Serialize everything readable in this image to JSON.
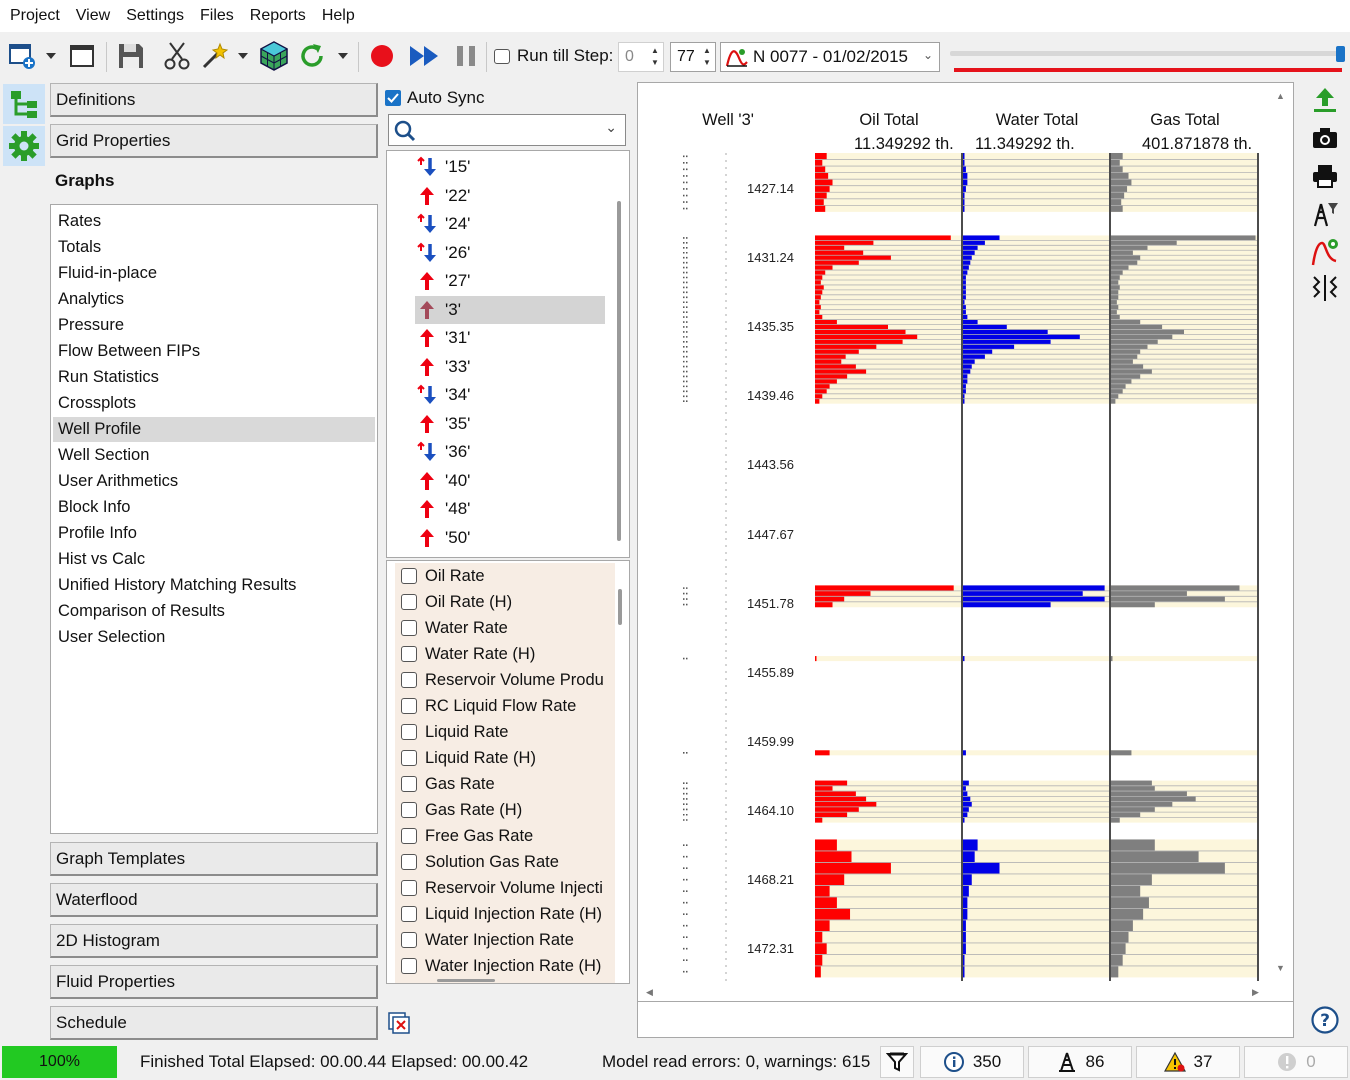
{
  "menu": [
    "Project",
    "View",
    "Settings",
    "Files",
    "Reports",
    "Help"
  ],
  "toolbar": {
    "run_till_step_label": "Run till Step:",
    "run_till_step_value": "0",
    "step_value": "77",
    "step_name": "N 0077 - 01/02/2015"
  },
  "left_panel": {
    "sections_top": [
      "Definitions",
      "Grid Properties",
      "Graphs"
    ],
    "graphs_items": [
      "Rates",
      "Totals",
      "Fluid-in-place",
      "Analytics",
      "Pressure",
      "Flow Between FIPs",
      "Run Statistics",
      "Crossplots",
      "Well Profile",
      "Well Section",
      "User Arithmetics",
      "Block Info",
      "Profile Info",
      "Hist vs Calc",
      "Unified History Matching Results",
      "Comparison of Results",
      "User Selection"
    ],
    "selected_graph": "Well Profile",
    "sections_bottom": [
      "Graph Templates",
      "Waterflood",
      "2D Histogram",
      "Fluid Properties",
      "Schedule"
    ]
  },
  "middle_panel": {
    "auto_sync_label": "Auto Sync",
    "search_value": "",
    "wells": [
      {
        "name": "'15'",
        "type": "injector"
      },
      {
        "name": "'22'",
        "type": "producer"
      },
      {
        "name": "'24'",
        "type": "injector"
      },
      {
        "name": "'26'",
        "type": "injector"
      },
      {
        "name": "'27'",
        "type": "producer"
      },
      {
        "name": "'3'",
        "type": "producer"
      },
      {
        "name": "'31'",
        "type": "producer"
      },
      {
        "name": "'33'",
        "type": "producer"
      },
      {
        "name": "'34'",
        "type": "injector"
      },
      {
        "name": "'35'",
        "type": "producer"
      },
      {
        "name": "'36'",
        "type": "injector"
      },
      {
        "name": "'40'",
        "type": "producer"
      },
      {
        "name": "'48'",
        "type": "producer"
      },
      {
        "name": "'50'",
        "type": "producer"
      }
    ],
    "selected_well": "'3'",
    "variables": [
      "Oil Rate",
      "Oil Rate (H)",
      "Water Rate",
      "Water Rate (H)",
      "Reservoir Volume Produ",
      "RC Liquid Flow Rate",
      "Liquid Rate",
      "Liquid Rate (H)",
      "Gas Rate",
      "Gas Rate (H)",
      "Free Gas Rate",
      "Solution Gas Rate",
      "Reservoir Volume Injecti",
      "Liquid Injection Rate (H)",
      "Water Injection Rate",
      "Water Injection Rate (H)"
    ]
  },
  "chart": {
    "well_label": "Well '3'",
    "tracks": [
      {
        "title": "Oil Total",
        "total": "11.349292 th."
      },
      {
        "title": "Water Total",
        "total": "11.349292 th."
      },
      {
        "title": "Gas Total",
        "total": "401.871878 th."
      }
    ],
    "depth_labels": [
      "1427.14",
      "1431.24",
      "1435.35",
      "1439.46",
      "1443.56",
      "1447.67",
      "1451.78",
      "1455.89",
      "1459.99",
      "1464.10",
      "1468.21",
      "1472.31"
    ],
    "colors": {
      "oil": "#ff0000",
      "water": "#0000e6",
      "gas": "#7f7f7f",
      "track_bg": "#fcf6dc",
      "grid": "#b4b4b4"
    }
  },
  "chart_data": {
    "type": "bar",
    "orientation": "horizontal",
    "y_axis": "depth",
    "ylim": [
      1425,
      1475
    ],
    "series": [
      {
        "name": "Oil Total",
        "segments": [
          {
            "top": 1425.0,
            "bottom": 1428.5,
            "values": [
              0.08,
              0.05,
              0.07,
              0.09,
              0.12,
              0.1,
              0.08,
              0.06,
              0.07
            ]
          },
          {
            "top": 1429.9,
            "bottom": 1439.9,
            "values": [
              0.93,
              0.4,
              0.2,
              0.33,
              0.52,
              0.3,
              0.12,
              0.07,
              0.05,
              0.04,
              0.06,
              0.05,
              0.04,
              0.03,
              0.04,
              0.03,
              0.05,
              0.15,
              0.5,
              0.62,
              0.7,
              0.6,
              0.42,
              0.3,
              0.21,
              0.18,
              0.28,
              0.35,
              0.22,
              0.15,
              0.1,
              0.08,
              0.05,
              0.03
            ]
          },
          {
            "top": 1450.7,
            "bottom": 1452.0,
            "values": [
              0.95,
              0.38,
              0.2,
              0.12
            ]
          },
          {
            "top": 1454.9,
            "bottom": 1455.2,
            "values": [
              0.01
            ]
          },
          {
            "top": 1460.5,
            "bottom": 1460.8,
            "values": [
              0.1
            ]
          },
          {
            "top": 1462.3,
            "bottom": 1464.8,
            "values": [
              0.22,
              0.12,
              0.28,
              0.35,
              0.42,
              0.3,
              0.22,
              0.05
            ]
          },
          {
            "top": 1465.8,
            "bottom": 1474.0,
            "values": [
              0.15,
              0.25,
              0.52,
              0.2,
              0.1,
              0.15,
              0.24,
              0.1,
              0.05,
              0.08,
              0.05,
              0.04
            ]
          }
        ]
      },
      {
        "name": "Water Total",
        "segments": [
          {
            "top": 1425.0,
            "bottom": 1428.5,
            "values": [
              0.01,
              0.01,
              0.02,
              0.03,
              0.03,
              0.02,
              0.01,
              0.01,
              0.01
            ]
          },
          {
            "top": 1429.9,
            "bottom": 1439.9,
            "values": [
              0.25,
              0.15,
              0.1,
              0.08,
              0.06,
              0.05,
              0.04,
              0.03,
              0.02,
              0.02,
              0.02,
              0.02,
              0.02,
              0.01,
              0.02,
              0.02,
              0.03,
              0.1,
              0.3,
              0.58,
              0.8,
              0.6,
              0.35,
              0.2,
              0.15,
              0.08,
              0.06,
              0.05,
              0.03,
              0.03,
              0.02,
              0.02,
              0.01,
              0.01
            ]
          },
          {
            "top": 1450.7,
            "bottom": 1452.0,
            "values": [
              0.97,
              0.82,
              0.97,
              0.6
            ]
          },
          {
            "top": 1454.9,
            "bottom": 1455.2,
            "values": [
              0.01
            ]
          },
          {
            "top": 1460.5,
            "bottom": 1460.8,
            "values": [
              0.02
            ]
          },
          {
            "top": 1462.3,
            "bottom": 1464.8,
            "values": [
              0.04,
              0.02,
              0.03,
              0.05,
              0.06,
              0.04,
              0.03,
              0.01
            ]
          },
          {
            "top": 1465.8,
            "bottom": 1474.0,
            "values": [
              0.1,
              0.08,
              0.25,
              0.06,
              0.04,
              0.03,
              0.03,
              0.02,
              0.02,
              0.02,
              0.01,
              0.01
            ]
          }
        ]
      },
      {
        "name": "Gas Total",
        "segments": [
          {
            "top": 1425.0,
            "bottom": 1428.5,
            "values": [
              0.08,
              0.06,
              0.08,
              0.12,
              0.14,
              0.11,
              0.09,
              0.07,
              0.08
            ]
          },
          {
            "top": 1429.9,
            "bottom": 1439.9,
            "values": [
              0.99,
              0.45,
              0.25,
              0.15,
              0.2,
              0.18,
              0.12,
              0.08,
              0.06,
              0.05,
              0.06,
              0.05,
              0.05,
              0.04,
              0.05,
              0.04,
              0.06,
              0.2,
              0.35,
              0.5,
              0.42,
              0.32,
              0.25,
              0.2,
              0.18,
              0.15,
              0.22,
              0.28,
              0.2,
              0.14,
              0.1,
              0.08,
              0.05,
              0.03
            ]
          },
          {
            "top": 1450.7,
            "bottom": 1452.0,
            "values": [
              0.88,
              0.52,
              0.78,
              0.3
            ]
          },
          {
            "top": 1454.9,
            "bottom": 1455.2,
            "values": [
              0.01
            ]
          },
          {
            "top": 1460.5,
            "bottom": 1460.8,
            "values": [
              0.14
            ]
          },
          {
            "top": 1462.3,
            "bottom": 1464.8,
            "values": [
              0.28,
              0.3,
              0.52,
              0.58,
              0.42,
              0.3,
              0.2,
              0.06
            ]
          },
          {
            "top": 1465.8,
            "bottom": 1474.0,
            "values": [
              0.3,
              0.6,
              0.78,
              0.28,
              0.2,
              0.26,
              0.22,
              0.15,
              0.12,
              0.1,
              0.08,
              0.05
            ]
          }
        ]
      }
    ]
  },
  "status": {
    "progress_percent": 100,
    "progress_label": "100%",
    "elapsed_text": "Finished Total Elapsed: 00.00.44 Elapsed: 00.00.42",
    "errors_text": "Model read errors: 0, warnings: 615",
    "info_count": "350",
    "wells_count": "86",
    "warnings_count": "37",
    "errors_count": "0"
  }
}
